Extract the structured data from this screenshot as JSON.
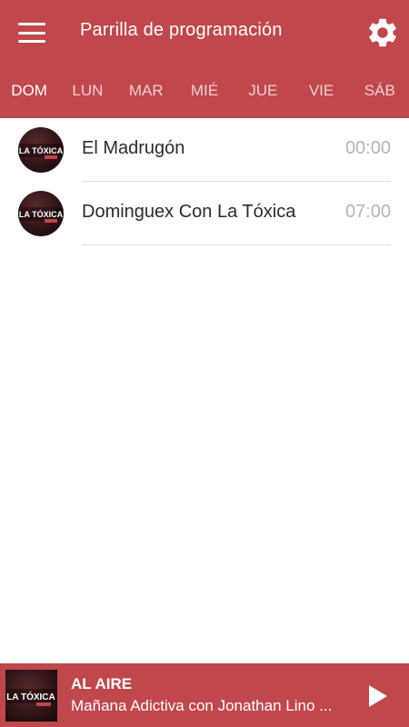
{
  "header": {
    "title": "Parrilla de programación",
    "menu_icon": "hamburger-menu-icon",
    "settings_icon": "gear-icon"
  },
  "tabs": [
    {
      "label": "DOM",
      "active": true
    },
    {
      "label": "LUN",
      "active": false
    },
    {
      "label": "MAR",
      "active": false
    },
    {
      "label": "MIÉ",
      "active": false
    },
    {
      "label": "JUE",
      "active": false
    },
    {
      "label": "VIE",
      "active": false
    },
    {
      "label": "SÁB",
      "active": false
    }
  ],
  "schedule": [
    {
      "title": "El Madrugón",
      "time": "00:00",
      "logo_text": "LA TÓXICA"
    },
    {
      "title": "Dominguex Con La Tóxica",
      "time": "07:00",
      "logo_text": "LA TÓXICA"
    }
  ],
  "player": {
    "label": "AL AIRE",
    "now_playing": "Mañana Adictiva con Jonathan Lino ...",
    "logo_text": "LA TÓXICA",
    "play_icon": "play-icon"
  },
  "colors": {
    "primary": "#c0474b",
    "text_dark": "#2b2b2b",
    "time_gray": "#b5b5b5",
    "divider": "#dcdcdc"
  }
}
